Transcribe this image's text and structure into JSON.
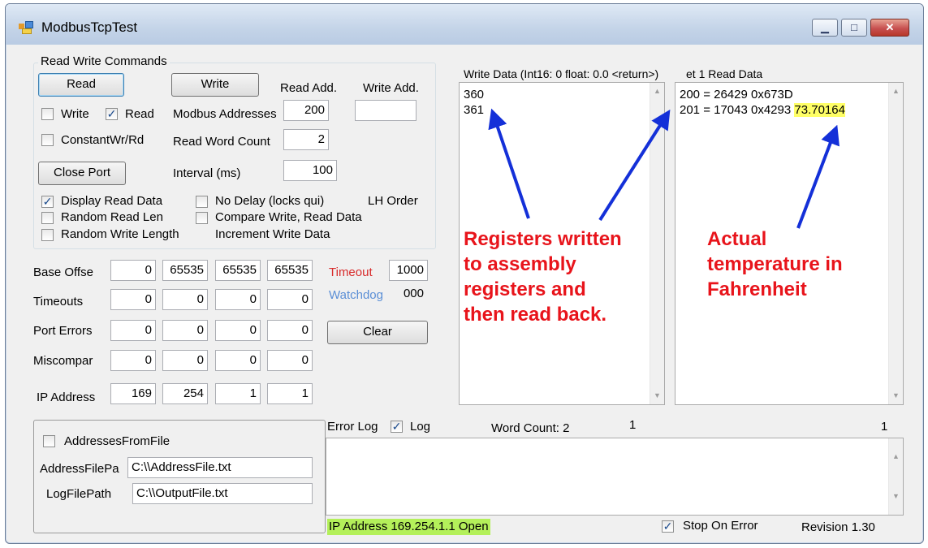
{
  "window": {
    "title": "ModbusTcpTest",
    "minimize_glyph": "▁",
    "maximize_glyph": "□",
    "close_glyph": "✕"
  },
  "rw_group": {
    "label": "Read Write Commands",
    "read_button": "Read",
    "write_button": "Write",
    "read_add_label": "Read Add.",
    "write_add_label": "Write Add.",
    "write_checkbox": "Write",
    "read_checkbox": "Read",
    "modbus_addresses_label": "Modbus Addresses",
    "modbus_addresses_value": "200",
    "write_address_value": "",
    "constant_checkbox": "ConstantWr/Rd",
    "read_word_count_label": "Read Word Count",
    "read_word_count_value": "2",
    "close_port_button": "Close Port",
    "interval_label": "Interval (ms)",
    "interval_value": "100",
    "display_read_data": "Display Read Data",
    "no_delay": "No Delay (locks qui)",
    "lh_order": "LH Order",
    "random_read_len": "Random Read Len",
    "compare_write_read": "Compare Write, Read Data",
    "random_write_length": "Random Write Length",
    "increment_write_data": "Increment Write Data"
  },
  "stats": {
    "rows": [
      {
        "label": "Base Offse",
        "values": [
          "0",
          "65535",
          "65535",
          "65535"
        ]
      },
      {
        "label": "Timeouts",
        "values": [
          "0",
          "0",
          "0",
          "0"
        ]
      },
      {
        "label": "Port Errors",
        "values": [
          "0",
          "0",
          "0",
          "0"
        ]
      },
      {
        "label": "Miscompar",
        "values": [
          "0",
          "0",
          "0",
          "0"
        ]
      },
      {
        "label": "IP Address",
        "values": [
          "169",
          "254",
          "1",
          "1"
        ]
      }
    ],
    "timeout_label": "Timeout",
    "timeout_value": "1000",
    "watchdog_label": "Watchdog",
    "watchdog_value": "000",
    "clear_button": "Clear"
  },
  "file_group": {
    "addresses_from_file": "AddressesFromFile",
    "address_file_path_label": "AddressFilePa",
    "address_file_path_value": "C:\\\\AddressFile.txt",
    "log_file_path_label": "LogFilePath",
    "log_file_path_value": "C:\\\\OutputFile.txt"
  },
  "write_data": {
    "label": "Write Data (Int16: 0 float: 0.0 <return>) ",
    "lines": [
      "360",
      "361"
    ]
  },
  "read_data": {
    "label": "ɑt 1 Read Data",
    "label_clean": "et 1 Read Data",
    "line1": "200 = 26429  0x673D",
    "line2": "201 = 17043  0x4293 ",
    "temperature": "73.70164"
  },
  "annotations": {
    "registers": "Registers written\nto assembly\nregisters and\nthen read back.",
    "temperature": "Actual\ntemperature in\nFahrenheit"
  },
  "log_row": {
    "error_log": "Error Log",
    "log": "Log",
    "word_count": "Word Count: 2",
    "count_a": "1",
    "count_b": "1"
  },
  "status": {
    "ip_status": "IP Address 169.254.1.1 Open",
    "stop_on_error": "Stop On Error",
    "revision": "Revision 1.30"
  },
  "checked": {
    "write": false,
    "read": true,
    "constant": false,
    "display_read_data": true,
    "no_delay": false,
    "random_read_len": false,
    "compare": false,
    "random_write_length": false,
    "addresses_from_file": false,
    "error_log": true,
    "stop_on_error": true
  },
  "colors": {
    "annotation": "#e8141b",
    "arrow": "#1430d8",
    "temp_highlight": "#ffff66",
    "status_highlight": "#b4f05a",
    "timeout_label": "#d82b2b",
    "watchdog_label": "#5b8fd6"
  }
}
